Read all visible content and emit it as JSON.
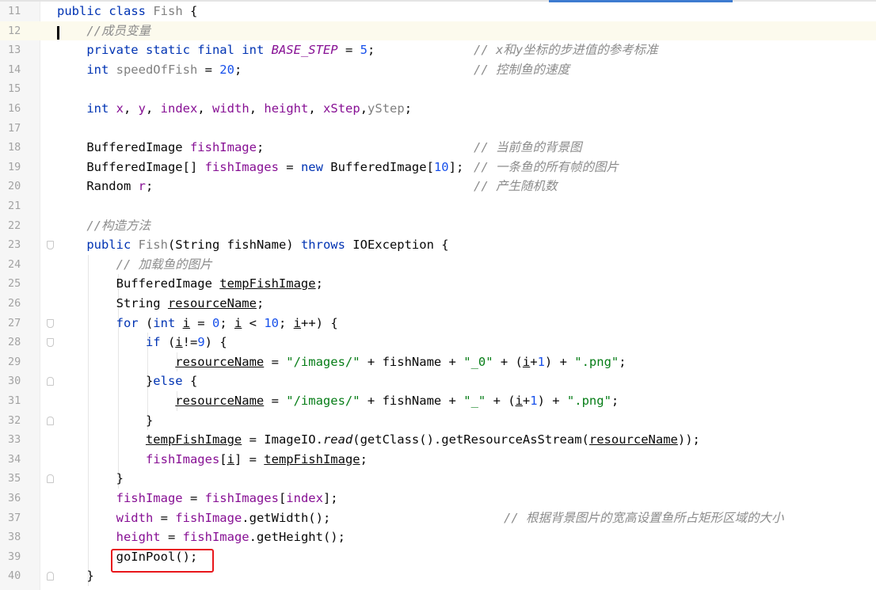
{
  "colors": {
    "keyword": "#0033b3",
    "field": "#871094",
    "number": "#1750eb",
    "string": "#067d17",
    "comment": "#8c8c8c",
    "highlight_box": "#e8161b",
    "current_line": "#fcfaed"
  },
  "current_line": 12,
  "highlighted_line": 39,
  "lines": [
    {
      "num": "11",
      "indent": 0,
      "tokens": [
        [
          "public class ",
          "k"
        ],
        [
          "Fish",
          "u"
        ],
        [
          " {",
          "p"
        ]
      ]
    },
    {
      "num": "12",
      "indent": 4,
      "tokens": [
        [
          "//成员变量",
          "c"
        ]
      ]
    },
    {
      "num": "13",
      "indent": 4,
      "tokens": [
        [
          "private static final int ",
          "k"
        ],
        [
          "BASE_STEP",
          "cf"
        ],
        [
          " = ",
          "p"
        ],
        [
          "5",
          "n"
        ],
        [
          ";",
          "p"
        ]
      ],
      "comment": "// x和y坐标的步进值的参考标准"
    },
    {
      "num": "14",
      "indent": 4,
      "tokens": [
        [
          "int ",
          "k"
        ],
        [
          "speedOfFish",
          "u"
        ],
        [
          " = ",
          "p"
        ],
        [
          "20",
          "n"
        ],
        [
          ";",
          "p"
        ]
      ],
      "comment": "// 控制鱼的速度"
    },
    {
      "num": "15",
      "indent": 0,
      "tokens": []
    },
    {
      "num": "16",
      "indent": 4,
      "tokens": [
        [
          "int ",
          "k"
        ],
        [
          "x",
          "f"
        ],
        [
          ", ",
          "p"
        ],
        [
          "y",
          "f"
        ],
        [
          ", ",
          "p"
        ],
        [
          "index",
          "f"
        ],
        [
          ", ",
          "p"
        ],
        [
          "width",
          "f"
        ],
        [
          ", ",
          "p"
        ],
        [
          "height",
          "f"
        ],
        [
          ", ",
          "p"
        ],
        [
          "xStep",
          "f"
        ],
        [
          ",",
          "p"
        ],
        [
          "yStep",
          "u"
        ],
        [
          ";",
          "p"
        ]
      ]
    },
    {
      "num": "17",
      "indent": 0,
      "tokens": []
    },
    {
      "num": "18",
      "indent": 4,
      "tokens": [
        [
          "BufferedImage ",
          "p"
        ],
        [
          "fishImage",
          "f"
        ],
        [
          ";",
          "p"
        ]
      ],
      "comment": "// 当前鱼的背景图"
    },
    {
      "num": "19",
      "indent": 4,
      "tokens": [
        [
          "BufferedImage[] ",
          "p"
        ],
        [
          "fishImages",
          "f"
        ],
        [
          " = ",
          "p"
        ],
        [
          "new ",
          "k"
        ],
        [
          "BufferedImage[",
          "p"
        ],
        [
          "10",
          "n"
        ],
        [
          "];",
          "p"
        ]
      ],
      "comment": "// 一条鱼的所有帧的图片"
    },
    {
      "num": "20",
      "indent": 4,
      "tokens": [
        [
          "Random ",
          "p"
        ],
        [
          "r",
          "f"
        ],
        [
          ";",
          "p"
        ]
      ],
      "comment": "// 产生随机数"
    },
    {
      "num": "21",
      "indent": 0,
      "tokens": []
    },
    {
      "num": "22",
      "indent": 4,
      "tokens": [
        [
          "//构造方法",
          "c"
        ]
      ]
    },
    {
      "num": "23",
      "indent": 4,
      "tokens": [
        [
          "public ",
          "k"
        ],
        [
          "Fish",
          "u"
        ],
        [
          "(String fishName) ",
          "p"
        ],
        [
          "throws ",
          "k"
        ],
        [
          "IOException {",
          "p"
        ]
      ],
      "fold": "start"
    },
    {
      "num": "24",
      "indent": 8,
      "tokens": [
        [
          "// 加载鱼的图片",
          "c"
        ]
      ]
    },
    {
      "num": "25",
      "indent": 8,
      "tokens": [
        [
          "BufferedImage ",
          "p"
        ],
        [
          "tempFishImage",
          "v"
        ],
        [
          ";",
          "p"
        ]
      ]
    },
    {
      "num": "26",
      "indent": 8,
      "tokens": [
        [
          "String ",
          "p"
        ],
        [
          "resourceName",
          "v"
        ],
        [
          ";",
          "p"
        ]
      ]
    },
    {
      "num": "27",
      "indent": 8,
      "tokens": [
        [
          "for ",
          "k"
        ],
        [
          "(",
          "p"
        ],
        [
          "int ",
          "k"
        ],
        [
          "i",
          "v"
        ],
        [
          " = ",
          "p"
        ],
        [
          "0",
          "n"
        ],
        [
          "; ",
          "p"
        ],
        [
          "i",
          "v"
        ],
        [
          " < ",
          "p"
        ],
        [
          "10",
          "n"
        ],
        [
          "; ",
          "p"
        ],
        [
          "i",
          "v"
        ],
        [
          "++) {",
          "p"
        ]
      ],
      "fold": "start"
    },
    {
      "num": "28",
      "indent": 12,
      "tokens": [
        [
          "if ",
          "k"
        ],
        [
          "(",
          "p"
        ],
        [
          "i",
          "v"
        ],
        [
          "!=",
          "p"
        ],
        [
          "9",
          "n"
        ],
        [
          ") {",
          "p"
        ]
      ],
      "fold": "start"
    },
    {
      "num": "29",
      "indent": 16,
      "tokens": [
        [
          "resourceName",
          "v"
        ],
        [
          " = ",
          "p"
        ],
        [
          "\"/images/\"",
          "s"
        ],
        [
          " + fishName + ",
          "p"
        ],
        [
          "\"_0\"",
          "s"
        ],
        [
          " + (",
          "p"
        ],
        [
          "i",
          "v"
        ],
        [
          "+",
          "p"
        ],
        [
          "1",
          "n"
        ],
        [
          ") + ",
          "p"
        ],
        [
          "\".png\"",
          "s"
        ],
        [
          ";",
          "p"
        ]
      ]
    },
    {
      "num": "30",
      "indent": 12,
      "tokens": [
        [
          "}",
          "p"
        ],
        [
          "else",
          "k"
        ],
        [
          " {",
          "p"
        ]
      ],
      "fold": "end"
    },
    {
      "num": "31",
      "indent": 16,
      "tokens": [
        [
          "resourceName",
          "v"
        ],
        [
          " = ",
          "p"
        ],
        [
          "\"/images/\"",
          "s"
        ],
        [
          " + fishName + ",
          "p"
        ],
        [
          "\"_\"",
          "s"
        ],
        [
          " + (",
          "p"
        ],
        [
          "i",
          "v"
        ],
        [
          "+",
          "p"
        ],
        [
          "1",
          "n"
        ],
        [
          ") + ",
          "p"
        ],
        [
          "\".png\"",
          "s"
        ],
        [
          ";",
          "p"
        ]
      ]
    },
    {
      "num": "32",
      "indent": 12,
      "tokens": [
        [
          "}",
          "p"
        ]
      ],
      "fold": "end"
    },
    {
      "num": "33",
      "indent": 12,
      "tokens": [
        [
          "tempFishImage",
          "v"
        ],
        [
          " = ImageIO.",
          "p"
        ],
        [
          "read",
          "m"
        ],
        [
          "(getClass().getResourceAsStream(",
          "p"
        ],
        [
          "resourceName",
          "v"
        ],
        [
          "));",
          "p"
        ]
      ]
    },
    {
      "num": "34",
      "indent": 12,
      "tokens": [
        [
          "fishImages",
          "f"
        ],
        [
          "[",
          "p"
        ],
        [
          "i",
          "v"
        ],
        [
          "] = ",
          "p"
        ],
        [
          "tempFishImage",
          "v"
        ],
        [
          ";",
          "p"
        ]
      ]
    },
    {
      "num": "35",
      "indent": 8,
      "tokens": [
        [
          "}",
          "p"
        ]
      ],
      "fold": "end"
    },
    {
      "num": "36",
      "indent": 8,
      "tokens": [
        [
          "fishImage",
          "f"
        ],
        [
          " = ",
          "p"
        ],
        [
          "fishImages",
          "f"
        ],
        [
          "[",
          "p"
        ],
        [
          "index",
          "f"
        ],
        [
          "];",
          "p"
        ]
      ]
    },
    {
      "num": "37",
      "indent": 8,
      "tokens": [
        [
          "width",
          "f"
        ],
        [
          " = ",
          "p"
        ],
        [
          "fishImage",
          "f"
        ],
        [
          ".getWidth();",
          "p"
        ]
      ],
      "comment": "// 根据背景图片的宽高设置鱼所占矩形区域的大小"
    },
    {
      "num": "38",
      "indent": 8,
      "tokens": [
        [
          "height",
          "f"
        ],
        [
          " = ",
          "p"
        ],
        [
          "fishImage",
          "f"
        ],
        [
          ".getHeight();",
          "p"
        ]
      ]
    },
    {
      "num": "39",
      "indent": 8,
      "tokens": [
        [
          "goInPool();",
          "p"
        ]
      ]
    },
    {
      "num": "40",
      "indent": 4,
      "tokens": [
        [
          "}",
          "p"
        ]
      ],
      "fold": "end"
    }
  ]
}
